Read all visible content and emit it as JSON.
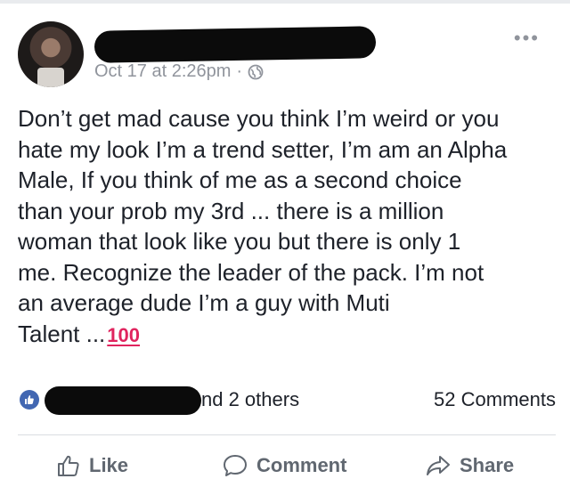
{
  "post": {
    "timestamp": "Oct 17 at 2:26pm",
    "separator": "·",
    "more_label": "•••",
    "text_lines": [
      "Don’t get mad cause you think I’m weird or you",
      "hate my look I’m a trend setter, I’m am an Alpha",
      "Male, If you think of me as a second choice",
      "than your prob my 3rd ... there is a million",
      "woman that look like you but there is only 1",
      "me. Recognize the leader of the pack. I’m not",
      "an average dude I’m a guy with Muti",
      "Talent ..."
    ],
    "emoji": "100",
    "emoji_color": "#e0245e"
  },
  "reactions": {
    "others_label": "nd 2 others",
    "comments_label": "52 Comments",
    "like_color": "#4267b2"
  },
  "actions": {
    "like": "Like",
    "comment": "Comment",
    "share": "Share"
  }
}
